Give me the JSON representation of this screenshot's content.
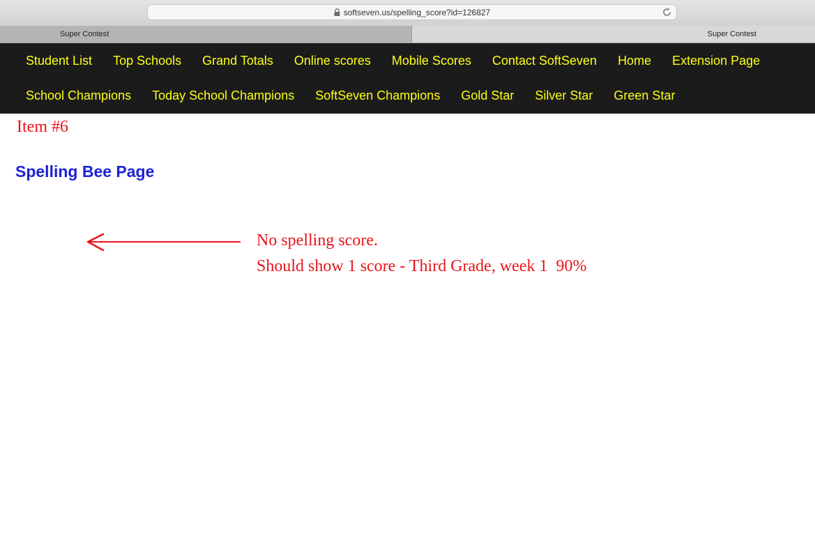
{
  "browser": {
    "url": "softseven.us/spelling_score?id=126827",
    "tabs": [
      {
        "label": "Super Contest"
      },
      {
        "label": "Super Contest"
      }
    ]
  },
  "nav": {
    "row1": [
      {
        "label": "Student List"
      },
      {
        "label": "Top Schools"
      },
      {
        "label": "Grand Totals"
      },
      {
        "label": "Online scores"
      },
      {
        "label": "Mobile Scores"
      },
      {
        "label": "Contact SoftSeven"
      },
      {
        "label": "Home"
      },
      {
        "label": "Extension Page"
      }
    ],
    "row2": [
      {
        "label": "School Champions"
      },
      {
        "label": "Today School Champions"
      },
      {
        "label": "SoftSeven Champions"
      },
      {
        "label": "Gold Star"
      },
      {
        "label": "Silver Star"
      },
      {
        "label": "Green Star"
      }
    ]
  },
  "annotations": {
    "item_label": "Item #6",
    "line1": "No spelling score.",
    "line2": "Should show 1 score - Third Grade, week 1  90%"
  },
  "page": {
    "title": "Spelling Bee Page"
  },
  "icons": {
    "lock": "lock-icon",
    "reload": "reload-icon",
    "arrow": "left-arrow-icon"
  },
  "colors": {
    "nav_background": "#1b1b1b",
    "nav_link": "#ffff1a",
    "annotation_red": "#e8141b",
    "title_blue": "#1b22d6"
  }
}
